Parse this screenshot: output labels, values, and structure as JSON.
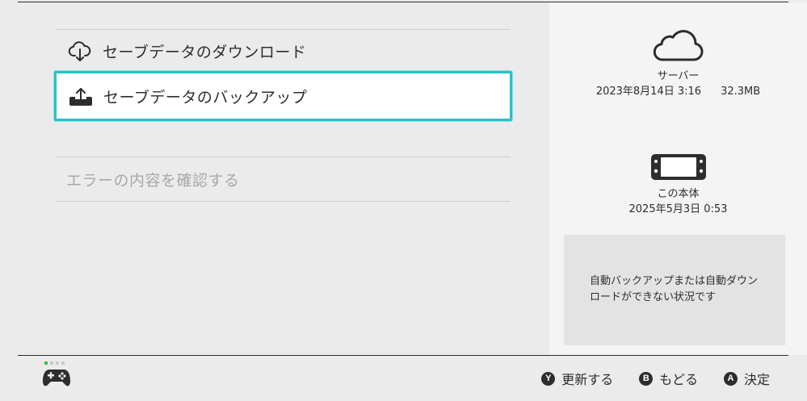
{
  "menu": {
    "download_label": "セーブデータのダウンロード",
    "backup_label": "セーブデータのバックアップ",
    "error_label": "エラーの内容を確認する"
  },
  "server": {
    "label": "サーバー",
    "date": "2023年8月14日 3:16",
    "size": "32.3MB"
  },
  "device": {
    "label": "この本体",
    "date": "2025年5月3日 0:53"
  },
  "notice": {
    "text": "自動バックアップまたは自動ダウンロードができない状況です"
  },
  "footer": {
    "actions": [
      {
        "glyph": "Y",
        "label": "更新する"
      },
      {
        "glyph": "B",
        "label": "もどる"
      },
      {
        "glyph": "A",
        "label": "決定"
      }
    ]
  },
  "colors": {
    "accent": "#26c2c6",
    "player_indicator": "#41c23c"
  },
  "icons": [
    "cloud-download-icon",
    "cloud-upload-icon",
    "cloud-icon",
    "switch-console-icon",
    "controller-icon"
  ]
}
